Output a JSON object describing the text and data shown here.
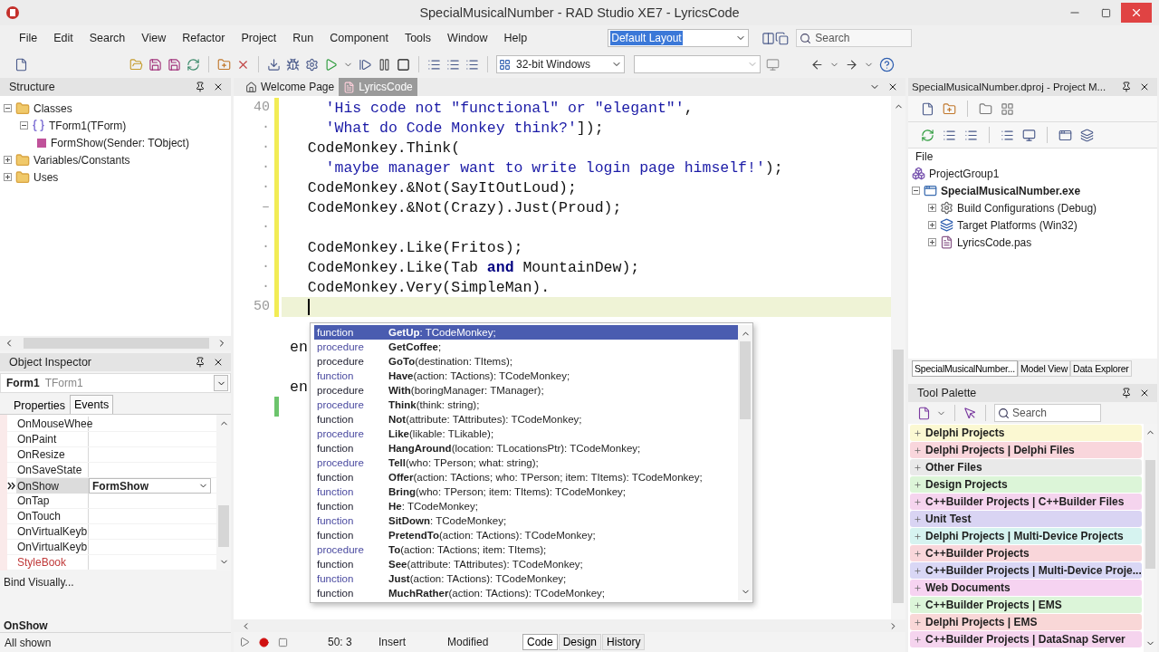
{
  "window": {
    "title": "SpecialMusicalNumber - RAD Studio XE7 - LyricsCode"
  },
  "menu": [
    "File",
    "Edit",
    "Search",
    "View",
    "Refactor",
    "Project",
    "Run",
    "Component",
    "Tools",
    "Window",
    "Help"
  ],
  "layout_combo": {
    "value": "Default Layout"
  },
  "search_field": {
    "placeholder": "Search"
  },
  "platform_combo": {
    "value": "32-bit Windows"
  },
  "structure": {
    "title": "Structure",
    "tree": [
      {
        "label": "Classes",
        "kind": "folder",
        "expanded": true,
        "children": [
          {
            "label": "TForm1(TForm)",
            "kind": "class",
            "expanded": true,
            "children": [
              {
                "label": "FormShow(Sender: TObject)",
                "kind": "method"
              }
            ]
          }
        ]
      },
      {
        "label": "Variables/Constants",
        "kind": "folder",
        "expanded": false
      },
      {
        "label": "Uses",
        "kind": "folder",
        "expanded": false
      }
    ]
  },
  "object_inspector": {
    "title": "Object Inspector",
    "object_name": "Form1",
    "object_type": "TForm1",
    "tabs": [
      {
        "label": "Properties",
        "selected": false
      },
      {
        "label": "Events",
        "selected": true
      }
    ],
    "events": [
      {
        "name": "OnMouseWhee",
        "selected": false
      },
      {
        "name": "OnPaint",
        "selected": false
      },
      {
        "name": "OnResize",
        "selected": false
      },
      {
        "name": "OnSaveState",
        "selected": false
      },
      {
        "name": "OnShow",
        "value": "FormShow",
        "selected": true
      },
      {
        "name": "OnTap",
        "selected": false
      },
      {
        "name": "OnTouch",
        "selected": false
      },
      {
        "name": "OnVirtualKeyb",
        "selected": false
      },
      {
        "name": "OnVirtualKeyb",
        "selected": false
      },
      {
        "name": "StyleBook",
        "selected": false
      }
    ],
    "bind_link": "Bind Visually...",
    "selected_event": "OnShow",
    "status": "All shown"
  },
  "editor": {
    "tabs": [
      {
        "label": "Welcome Page",
        "selected": false
      },
      {
        "label": "LyricsCode",
        "selected": true
      }
    ],
    "lines": [
      {
        "gutter": "40",
        "modified": true,
        "saved": false,
        "current": false,
        "segments": [
          {
            "kind": "string",
            "text": "    'His code not \"functional\" or \"elegant\"'"
          },
          {
            "kind": "plain",
            "text": ","
          }
        ]
      },
      {
        "gutter": "·",
        "modified": true,
        "saved": false,
        "current": false,
        "segments": [
          {
            "kind": "string",
            "text": "    'What do Code Monkey think?'"
          },
          {
            "kind": "plain",
            "text": "]);"
          }
        ]
      },
      {
        "gutter": "·",
        "modified": true,
        "saved": false,
        "current": false,
        "segments": [
          {
            "kind": "plain",
            "text": "  CodeMonkey.Think("
          }
        ]
      },
      {
        "gutter": "·",
        "modified": true,
        "saved": false,
        "current": false,
        "segments": [
          {
            "kind": "string",
            "text": "    'maybe manager want to write login page himself!'"
          },
          {
            "kind": "plain",
            "text": ");"
          }
        ]
      },
      {
        "gutter": "·",
        "modified": true,
        "saved": false,
        "current": false,
        "segments": [
          {
            "kind": "plain",
            "text": "  CodeMonkey.&Not(SayItOutLoud);"
          }
        ]
      },
      {
        "gutter": "–",
        "modified": true,
        "saved": false,
        "current": false,
        "segments": [
          {
            "kind": "plain",
            "text": "  CodeMonkey.&Not(Crazy).Just(Proud);"
          }
        ]
      },
      {
        "gutter": "·",
        "modified": true,
        "saved": false,
        "current": false
      },
      {
        "gutter": "·",
        "modified": true,
        "saved": false,
        "current": false,
        "segments": [
          {
            "kind": "plain",
            "text": "  CodeMonkey.Like(Fritos);"
          }
        ]
      },
      {
        "gutter": "·",
        "modified": true,
        "saved": false,
        "current": false,
        "segments": [
          {
            "kind": "plain",
            "text": "  CodeMonkey.Like(Tab "
          },
          {
            "kind": "keyword",
            "text": "and"
          },
          {
            "kind": "plain",
            "text": " MountainDew);"
          }
        ]
      },
      {
        "gutter": "·",
        "modified": true,
        "saved": false,
        "current": false,
        "segments": [
          {
            "kind": "plain",
            "text": "  CodeMonkey.Very(SimpleMan)."
          }
        ]
      },
      {
        "gutter": "50",
        "modified": true,
        "saved": false,
        "current": true
      },
      {
        "modified": false,
        "saved": false,
        "current": false
      },
      {
        "modified": false,
        "saved": false,
        "current": false,
        "segments": [
          {
            "kind": "plain",
            "text": "en"
          }
        ]
      },
      {
        "modified": false,
        "saved": false,
        "current": false
      },
      {
        "modified": false,
        "saved": false,
        "current": false,
        "segments": [
          {
            "kind": "plain",
            "text": "en"
          }
        ]
      },
      {
        "modified": false,
        "saved": true,
        "current": false
      }
    ],
    "completion": [
      {
        "category": "function",
        "signature": "**GetUp**: TCodeMonkey;",
        "selected": true
      },
      {
        "category": "procedure",
        "signature": "**GetCoffee**;",
        "selected": false
      },
      {
        "category": "procedure",
        "signature": "**GoTo**(destination: TItems);",
        "selected": false
      },
      {
        "category": "function",
        "signature": "**Have**(action: TActions): TCodeMonkey;",
        "selected": false
      },
      {
        "category": "procedure",
        "signature": "**With**(boringManager: TManager);",
        "selected": false
      },
      {
        "category": "procedure",
        "signature": "**Think**(think: string);",
        "selected": false
      },
      {
        "category": "function",
        "signature": "**Not**(attribute: TAttributes): TCodeMonkey;",
        "selected": false
      },
      {
        "category": "procedure",
        "signature": "**Like**(likable: TLikable);",
        "selected": false
      },
      {
        "category": "function",
        "signature": "**HangAround**(location: TLocationsPtr): TCodeMonkey;",
        "selected": false
      },
      {
        "category": "procedure",
        "signature": "**Tell**(who: TPerson; what: string);",
        "selected": false
      },
      {
        "category": "function",
        "signature": "**Offer**(action: TActions; who: TPerson; item: TItems): TCodeMonkey;",
        "selected": false
      },
      {
        "category": "function",
        "signature": "**Bring**(who: TPerson; item: TItems): TCodeMonkey;",
        "selected": false
      },
      {
        "category": "function",
        "signature": "**He**: TCodeMonkey;",
        "selected": false
      },
      {
        "category": "function",
        "signature": "**SitDown**: TCodeMonkey;",
        "selected": false
      },
      {
        "category": "function",
        "signature": "**PretendTo**(action: TActions): TCodeMonkey;",
        "selected": false
      },
      {
        "category": "procedure",
        "signature": "**To**(action: TActions; item: TItems);",
        "selected": false
      },
      {
        "category": "function",
        "signature": "**See**(attribute: TAttributes): TCodeMonkey;",
        "selected": false
      },
      {
        "category": "function",
        "signature": "**Just**(action: TActions): TCodeMonkey;",
        "selected": false
      },
      {
        "category": "function",
        "signature": "**MuchRather**(action: TActions): TCodeMonkey;",
        "selected": false
      }
    ],
    "status": {
      "position": "50:  3",
      "mode": "Insert",
      "state": "Modified"
    },
    "view_tabs": [
      {
        "label": "Code",
        "selected": true
      },
      {
        "label": "Design",
        "selected": false
      },
      {
        "label": "History",
        "selected": false
      }
    ]
  },
  "project_manager": {
    "title": "SpecialMusicalNumber.dproj - Project M...",
    "column": "File",
    "tree": [
      {
        "label": "ProjectGroup1",
        "kind": "group"
      },
      {
        "label": "SpecialMusicalNumber.exe",
        "kind": "application",
        "expanded": true,
        "children": [
          {
            "label": "Build Configurations (Debug)",
            "kind": "configurations",
            "expanded": false
          },
          {
            "label": "Target Platforms (Win32)",
            "kind": "platforms",
            "expanded": false
          },
          {
            "label": "LyricsCode.pas",
            "kind": "unit",
            "expanded": false
          }
        ]
      }
    ],
    "tabs": [
      {
        "label": "SpecialMusicalNumber...",
        "selected": true
      },
      {
        "label": "Model View",
        "selected": false
      },
      {
        "label": "Data Explorer",
        "selected": false
      }
    ]
  },
  "tool_palette": {
    "title": "Tool Palette",
    "search_placeholder": "Search",
    "categories": [
      {
        "label": "Delphi Projects",
        "color": "#fbf8d2"
      },
      {
        "label": "Delphi Projects | Delphi Files",
        "color": "#f9d6dc"
      },
      {
        "label": "Other Files",
        "color": "#e9e9e9"
      },
      {
        "label": "Design Projects",
        "color": "#dcf5d8"
      },
      {
        "label": "C++Builder Projects | C++Builder Files",
        "color": "#f5d4ee"
      },
      {
        "label": "Unit Test",
        "color": "#d9d4f3"
      },
      {
        "label": "Delphi Projects | Multi-Device Projects",
        "color": "#d6f3f0"
      },
      {
        "label": "C++Builder Projects",
        "color": "#f9d6da"
      },
      {
        "label": "C++Builder Projects | Multi-Device Proje...",
        "color": "#d9d7f5"
      },
      {
        "label": "Web Documents",
        "color": "#f6d3f1"
      },
      {
        "label": "C++Builder Projects | EMS",
        "color": "#dcf5d9"
      },
      {
        "label": "Delphi Projects | EMS",
        "color": "#f9d7d7"
      },
      {
        "label": "C++Builder Projects | DataSnap Server",
        "color": "#f5d4ee"
      }
    ]
  }
}
